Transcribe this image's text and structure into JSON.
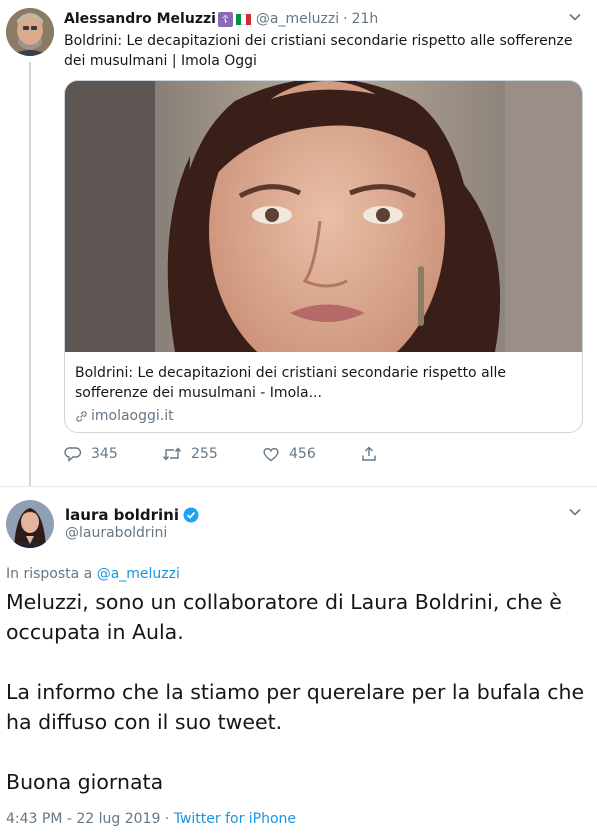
{
  "tweet1": {
    "author_name": "Alessandro Meluzzi",
    "author_handle": "@a_meluzzi",
    "dot": "·",
    "time": "21h",
    "text": "Boldrini: Le decapitazioni dei cristiani secondarie rispetto alle sofferenze dei musulmani | Imola Oggi",
    "card": {
      "title": "Boldrini: Le decapitazioni dei cristiani secondarie rispetto alle sofferenze dei musulmani - Imola...",
      "domain": "imolaoggi.it"
    },
    "actions": {
      "replies": "345",
      "retweets": "255",
      "likes": "456"
    }
  },
  "tweet2": {
    "author_name": "laura boldrini",
    "author_handle": "@lauraboldrini",
    "reply_prefix": "In risposta a ",
    "reply_handle": "@a_meluzzi",
    "paragraphs": [
      "Meluzzi, sono un collaboratore di Laura Boldrini, che è occupata in Aula.",
      "La informo che la stiamo per querelare per la bufala che ha diffuso con il suo tweet.",
      "Buona giornata"
    ],
    "timestamp": "4:43 PM - 22 lug 2019",
    "separator": " · ",
    "source": "Twitter for iPhone"
  },
  "icons": [
    "cross-badge-icon",
    "italy-flag-icon",
    "chevron-down-icon",
    "link-icon",
    "reply-icon",
    "retweet-icon",
    "like-icon",
    "share-icon",
    "verified-icon"
  ],
  "colors": {
    "link": "#1b95e0",
    "secondary": "#657786",
    "border": "#ccd6dd",
    "verified": "#1da1f2"
  }
}
